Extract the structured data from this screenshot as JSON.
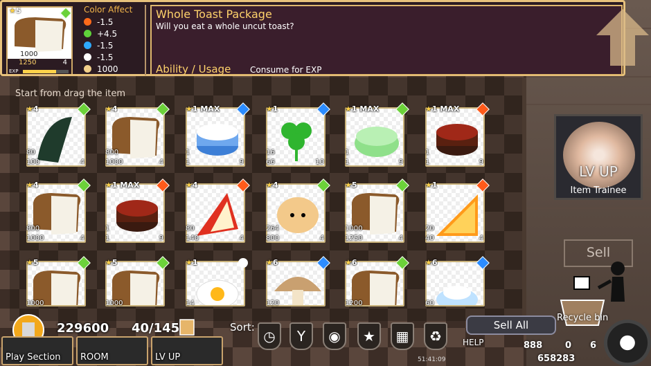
{
  "selected": {
    "rank": "5",
    "value1": "1000",
    "value2": "1250",
    "value3": "4",
    "exp_label": "EXP",
    "exp_fill": 0.72
  },
  "color_affect": {
    "title": "Color Affect",
    "rows": [
      {
        "icon": "fire-icon",
        "color": "#ff6a1a",
        "value": "-1.5"
      },
      {
        "icon": "leaf-gem-icon",
        "color": "#5fd23a",
        "value": "+4.5"
      },
      {
        "icon": "water-icon",
        "color": "#2ea9ff",
        "value": "-1.5"
      },
      {
        "icon": "white-orb-icon",
        "color": "#ffffff",
        "value": "-1.5"
      },
      {
        "icon": "hand-icon",
        "color": "#f2cf8a",
        "value": "1000"
      }
    ]
  },
  "item": {
    "name": "Whole Toast Package",
    "description": "Will you eat a whole uncut toast?",
    "ability_label": "Ability / Usage",
    "ability_value": "Consume for EXP"
  },
  "hint": "Start from drag the item",
  "items": [
    {
      "rank": "4",
      "gem": "green",
      "v1": "80",
      "v2": "100",
      "v3": "4",
      "art": "seaweed"
    },
    {
      "rank": "4",
      "gem": "green",
      "v1": "800",
      "v2": "1000",
      "v3": "4",
      "art": "bread"
    },
    {
      "rank": "1 MAX",
      "gem": "blue",
      "v1": "1",
      "v2": "1",
      "v3": "9",
      "art": "blue-cake"
    },
    {
      "rank": "1",
      "gem": "blue",
      "v1": "16",
      "v2": "66",
      "v3": "10",
      "art": "clover"
    },
    {
      "rank": "1 MAX",
      "gem": "green",
      "v1": "1",
      "v2": "1",
      "v3": "9",
      "art": "green-cake"
    },
    {
      "rank": "1 MAX",
      "gem": "red",
      "v1": "1",
      "v2": "1",
      "v3": "9",
      "art": "choc-cake"
    },
    {
      "rank": "4",
      "gem": "green",
      "v1": "800",
      "v2": "1000",
      "v3": "4",
      "art": "bread"
    },
    {
      "rank": "1 MAX",
      "gem": "red",
      "v1": "1",
      "v2": "1",
      "v3": "9",
      "art": "choc-cake"
    },
    {
      "rank": "4",
      "gem": "red",
      "v1": "80",
      "v2": "140",
      "v3": "4",
      "art": "apple"
    },
    {
      "rank": "4",
      "gem": "green",
      "v1": "264",
      "v2": "800",
      "v3": "4",
      "art": "bun"
    },
    {
      "rank": "5",
      "gem": "green",
      "v1": "1000",
      "v2": "1250",
      "v3": "4",
      "art": "bread"
    },
    {
      "rank": "1",
      "gem": "red",
      "v1": "20",
      "v2": "40",
      "v3": "4",
      "art": "orange"
    },
    {
      "rank": "5",
      "gem": "green",
      "v1": "1000",
      "v2": "",
      "v3": "",
      "art": "bread"
    },
    {
      "rank": "5",
      "gem": "green",
      "v1": "1000",
      "v2": "",
      "v3": "",
      "art": "bread"
    },
    {
      "rank": "1",
      "gem": "white",
      "v1": "14",
      "v2": "",
      "v3": "",
      "art": "egg"
    },
    {
      "rank": "6",
      "gem": "blue",
      "v1": "120",
      "v2": "",
      "v3": "",
      "art": "mushroom"
    },
    {
      "rank": "6",
      "gem": "green",
      "v1": "1200",
      "v2": "",
      "v3": "",
      "art": "bread"
    },
    {
      "rank": "6",
      "gem": "blue",
      "v1": "60",
      "v2": "",
      "v3": "",
      "art": "water-bowl"
    }
  ],
  "right_panel": {
    "lvup_label": "LV UP",
    "trainee_label": "Item Trainee",
    "sell_label": "Sell",
    "recycle_label": "Recycle bin"
  },
  "bottom": {
    "gold": "229600",
    "count": "40/145",
    "nav": [
      {
        "id": "play",
        "label": "Play Section"
      },
      {
        "id": "room",
        "label": "ROOM"
      },
      {
        "id": "lvup",
        "label": "LV UP"
      }
    ],
    "sort_label": "Sort:",
    "sort_buttons": [
      {
        "name": "sort-time-button",
        "glyph": "◷"
      },
      {
        "name": "sort-type-button",
        "glyph": "Y"
      },
      {
        "name": "sort-cat-button",
        "glyph": "◉"
      },
      {
        "name": "sort-star-button",
        "glyph": "★"
      },
      {
        "name": "sort-tile-button",
        "glyph": "▦"
      },
      {
        "name": "sort-recycle-button",
        "glyph": "♻"
      }
    ],
    "sell_all": "Sell All",
    "help": "HELP",
    "time": "51:41:09",
    "res1": "888",
    "res2": "0",
    "res3": "658283",
    "res4": "6"
  },
  "colors": {
    "green": "#6cd23a",
    "blue": "#2b8cff",
    "red": "#ff5a1a",
    "white": "#ffffff",
    "accent": "#e8c27c"
  }
}
